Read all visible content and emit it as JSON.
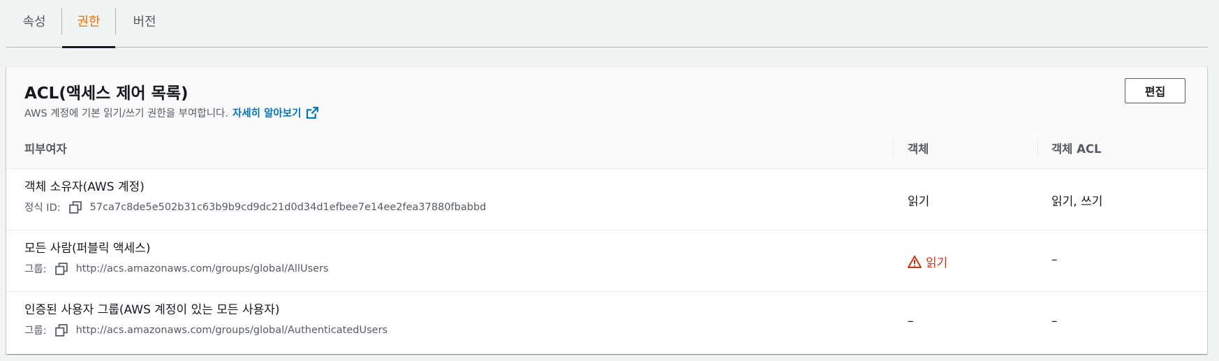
{
  "tabs": [
    {
      "label": "속성",
      "active": false
    },
    {
      "label": "권한",
      "active": true
    },
    {
      "label": "버전",
      "active": false
    }
  ],
  "acl": {
    "title": "ACL(액세스 제어 목록)",
    "description": "AWS 계정에 기본 읽기/쓰기 권한을 부여합니다.",
    "learn_more": "자세히 알아보기",
    "edit_label": "편집",
    "columns": {
      "grantee": "피부여자",
      "object": "객체",
      "object_acl": "객체 ACL"
    },
    "rows": [
      {
        "grantee": "객체 소유자(AWS 계정)",
        "id_label": "정식 ID:",
        "id_value": "57ca7c8de5e502b31c63b9b9cd9dc21d0d34d1efbee7e14ee2fea37880fbabbd",
        "object": "읽기",
        "object_warning": false,
        "object_acl": "읽기, 쓰기"
      },
      {
        "grantee": "모든 사람(퍼블릭 액세스)",
        "id_label": "그룹:",
        "id_value": "http://acs.amazonaws.com/groups/global/AllUsers",
        "object": "읽기",
        "object_warning": true,
        "object_acl": "–"
      },
      {
        "grantee": "인증된 사용자 그룹(AWS 계정이 있는 모든 사용자)",
        "id_label": "그룹:",
        "id_value": "http://acs.amazonaws.com/groups/global/AuthenticatedUsers",
        "object": "–",
        "object_warning": false,
        "object_acl": "–"
      }
    ]
  },
  "colors": {
    "active_tab": "#ec7211",
    "link": "#0073bb",
    "warning": "#d13212"
  }
}
